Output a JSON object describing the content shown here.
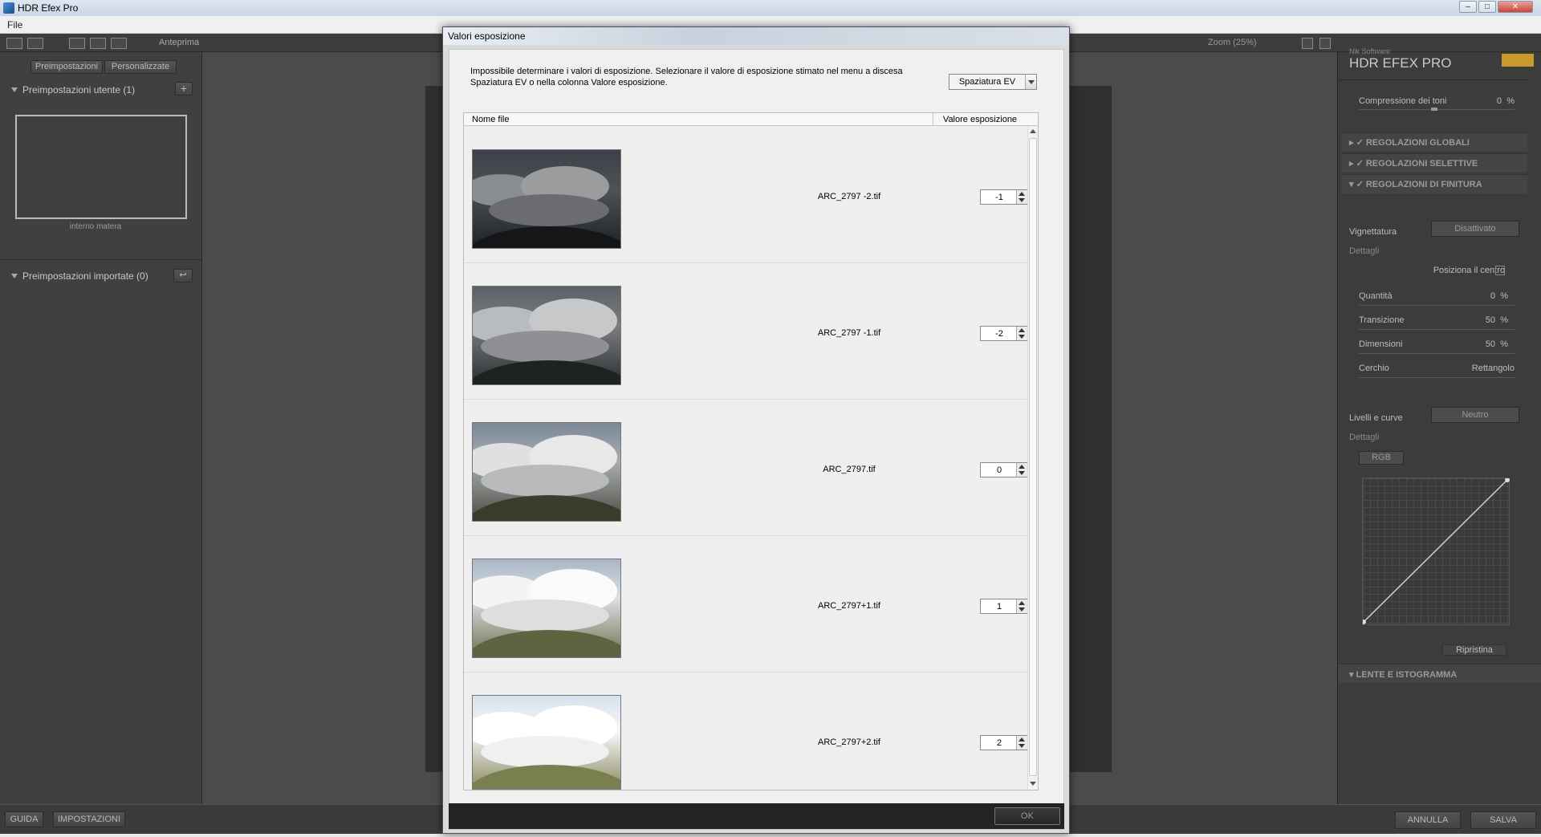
{
  "window": {
    "title": "HDR Efex Pro"
  },
  "menubar": {
    "file": "File"
  },
  "left_toolbar": {
    "preview_button": "Anteprima",
    "tabs": [
      "Preimpostazioni",
      "Personalizzate"
    ],
    "user_presets_header": "Preimpostazioni utente (1)",
    "preset_name": "interno matera",
    "imported_presets_header": "Preimpostazioni importate (0)"
  },
  "top_toolbar": {
    "zoom": "Zoom (25%)"
  },
  "right_panel": {
    "vendor": "Nik Software",
    "product": "HDR EFEX PRO",
    "tone_compression": {
      "label": "Compressione dei toni",
      "value": "0",
      "unit": "%"
    },
    "sections": [
      "REGOLAZIONI GLOBALI",
      "REGOLAZIONI SELETTIVE",
      "REGOLAZIONI DI FINITURA",
      "LENTE E ISTOGRAMMA"
    ],
    "vignette": {
      "label": "Vignettatura",
      "dropdown": "Disattivato",
      "details": "Dettagli",
      "center": "Posiziona il centro"
    },
    "vignette_sliders": [
      {
        "label": "Quantità",
        "value": "0",
        "unit": "%"
      },
      {
        "label": "Transizione",
        "value": "50",
        "unit": "%"
      },
      {
        "label": "Dimensioni",
        "value": "50",
        "unit": "%"
      },
      {
        "label": "Cerchio",
        "value": "Rettangolo",
        "unit": ""
      }
    ],
    "levels": {
      "label": "Livelli e curve",
      "dropdown": "Neutro",
      "details": "Dettagli",
      "channel": "RGB",
      "reset": "Ripristina"
    }
  },
  "bottom_bar": {
    "help": "GUIDA",
    "settings": "IMPOSTAZIONI",
    "cancel": "ANNULLA",
    "save": "SALVA"
  },
  "dialog": {
    "title": "Valori esposizione",
    "message": "Impossibile determinare i valori di esposizione. Selezionare il valore di esposizione stimato nel menu a discesa Spaziatura EV o nella colonna Valore esposizione.",
    "ev_spacing": "Spaziatura EV",
    "columns": {
      "file": "Nome file",
      "exposure": "Valore esposizione"
    },
    "rows": [
      {
        "file": "ARC_2797 -2.tif",
        "exposure": "-1"
      },
      {
        "file": "ARC_2797 -1.tif",
        "exposure": "-2"
      },
      {
        "file": "ARC_2797.tif",
        "exposure": "0"
      },
      {
        "file": "ARC_2797+1.tif",
        "exposure": "1"
      },
      {
        "file": "ARC_2797+2.tif",
        "exposure": "2"
      }
    ],
    "ok": "OK"
  },
  "colors": {
    "dialog_bg": "#f0f0f0",
    "app_bg": "#3a3a3a",
    "panel_bg": "#404040"
  }
}
